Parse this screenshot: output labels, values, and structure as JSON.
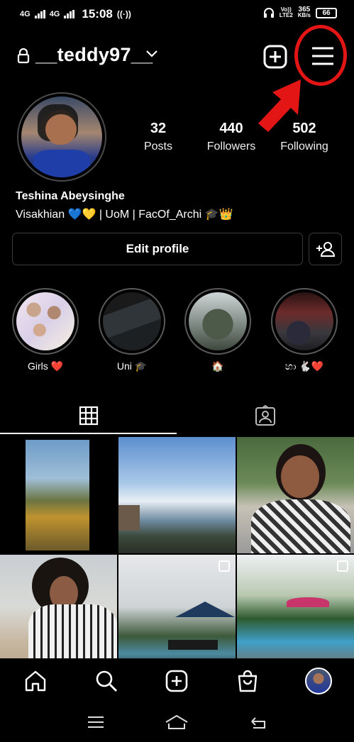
{
  "status_bar": {
    "net1": "4G",
    "net2": "4G",
    "time": "15:08",
    "volte": "Vo))",
    "lte": "LTE2",
    "speed_num": "365",
    "speed_unit": "KB/s",
    "battery": "66"
  },
  "header": {
    "username": "__teddy97__"
  },
  "profile": {
    "posts_count": "32",
    "posts_label": "Posts",
    "followers_count": "440",
    "followers_label": "Followers",
    "following_count": "502",
    "following_label": "Following",
    "name": "Teshina Abeysinghe",
    "bio": "Visakhian 💙💛 | UoM | FacOf_Archi 🎓👑",
    "edit_label": "Edit profile"
  },
  "highlights": [
    {
      "label": "Girls ❤️"
    },
    {
      "label": "Uni 🎓"
    },
    {
      "label": "🏠"
    },
    {
      "label": "හා 🐇❤️"
    }
  ],
  "tabs": [
    {
      "icon": "grid-icon",
      "active": true
    },
    {
      "icon": "tagged-icon",
      "active": false
    }
  ],
  "bottom_nav": [
    "home-icon",
    "search-icon",
    "create-icon",
    "shop-icon",
    "profile-avatar"
  ],
  "colors": {
    "background": "#000000",
    "annotation": "#e31515",
    "border": "#3b3b3b"
  }
}
